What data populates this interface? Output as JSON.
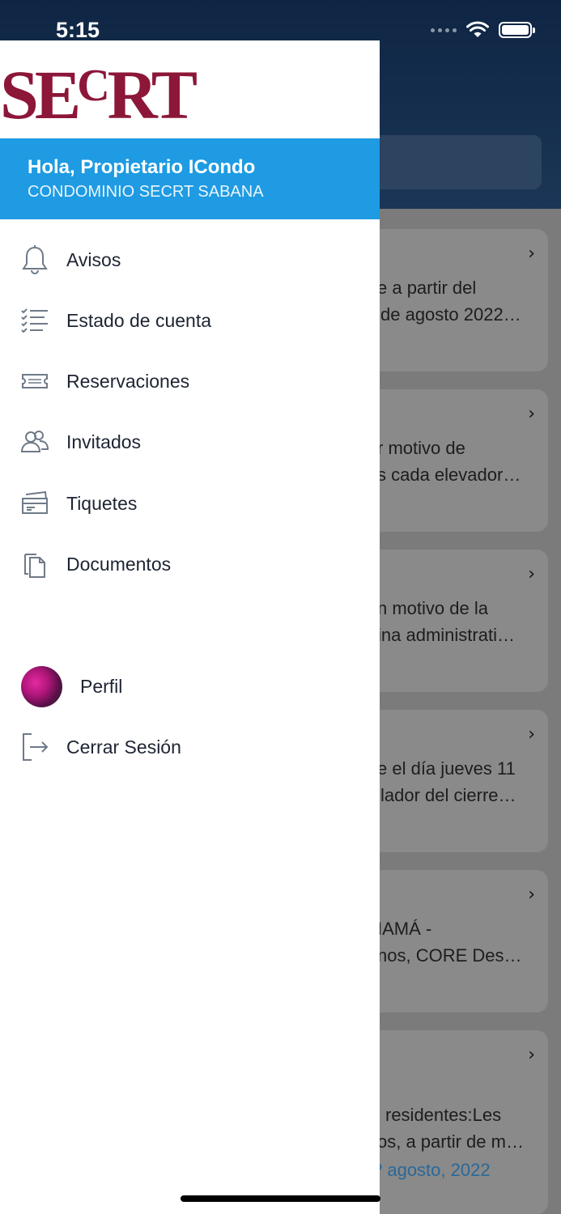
{
  "status_bar": {
    "time": "5:15"
  },
  "drawer": {
    "logo": {
      "main": "SE",
      "small": "C",
      "rest": "RT"
    },
    "greeting": "Hola, Propietario ICondo",
    "condominium": "CONDOMINIO SECRT SABANA",
    "menu": [
      {
        "label": "Avisos",
        "icon": "bell-icon"
      },
      {
        "label": "Estado de cuenta",
        "icon": "checklist-icon"
      },
      {
        "label": "Reservaciones",
        "icon": "ticket-icon"
      },
      {
        "label": "Invitados",
        "icon": "guests-icon"
      },
      {
        "label": "Tiquetes",
        "icon": "tickets-icon"
      },
      {
        "label": "Documentos",
        "icon": "documents-icon"
      }
    ],
    "profile": {
      "label": "Perfil"
    },
    "logout": {
      "label": "Cerrar Sesión",
      "icon": "logout-icon"
    }
  },
  "background_cards": [
    {
      "line1": "e a partir del",
      "line2": "de agosto 2022…"
    },
    {
      "line1": "r motivo de",
      "line2": "s cada elevador…"
    },
    {
      "line1": "n motivo de la",
      "line2": "ina administrati…"
    },
    {
      "line1": "e el día jueves 11",
      "line2": "lador del cierre…"
    },
    {
      "line1": "IAMÁ -",
      "line2": "nos, CORE Des…"
    },
    {
      "line1": "residentes:Les",
      "line2": "os, a partir de m…",
      "date": "? agosto, 2022"
    }
  ],
  "colors": {
    "brand": "#8c1738",
    "accent": "#1e9be2",
    "header": "#0f2544"
  }
}
